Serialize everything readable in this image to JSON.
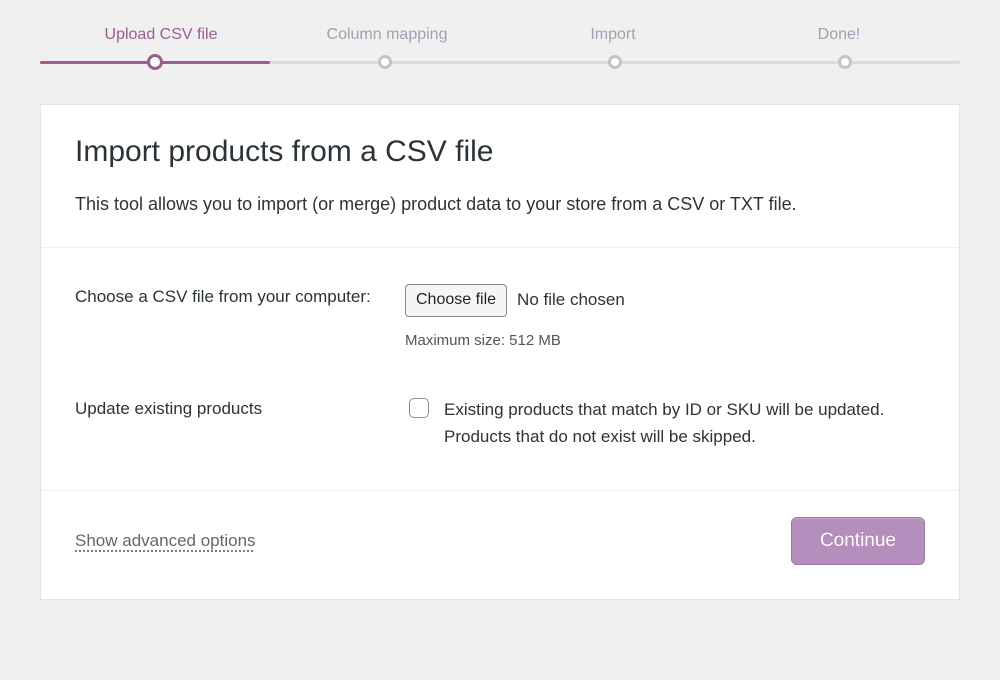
{
  "stepper": {
    "steps": [
      {
        "label": "Upload CSV file",
        "active": true
      },
      {
        "label": "Column mapping",
        "active": false
      },
      {
        "label": "Import",
        "active": false
      },
      {
        "label": "Done!",
        "active": false
      }
    ]
  },
  "header": {
    "title": "Import products from a CSV file",
    "description": "This tool allows you to import (or merge) product data to your store from a CSV or TXT file."
  },
  "form": {
    "choose_file": {
      "label": "Choose a CSV file from your computer:",
      "button_label": "Choose file",
      "status": "No file chosen",
      "hint": "Maximum size: 512 MB"
    },
    "update_existing": {
      "label": "Update existing products",
      "checked": false,
      "description": "Existing products that match by ID or SKU will be updated. Products that do not exist will be skipped."
    }
  },
  "footer": {
    "advanced_link": "Show advanced options",
    "continue_label": "Continue"
  },
  "colors": {
    "accent": "#9b5c8f",
    "button": "#b48ebc"
  }
}
